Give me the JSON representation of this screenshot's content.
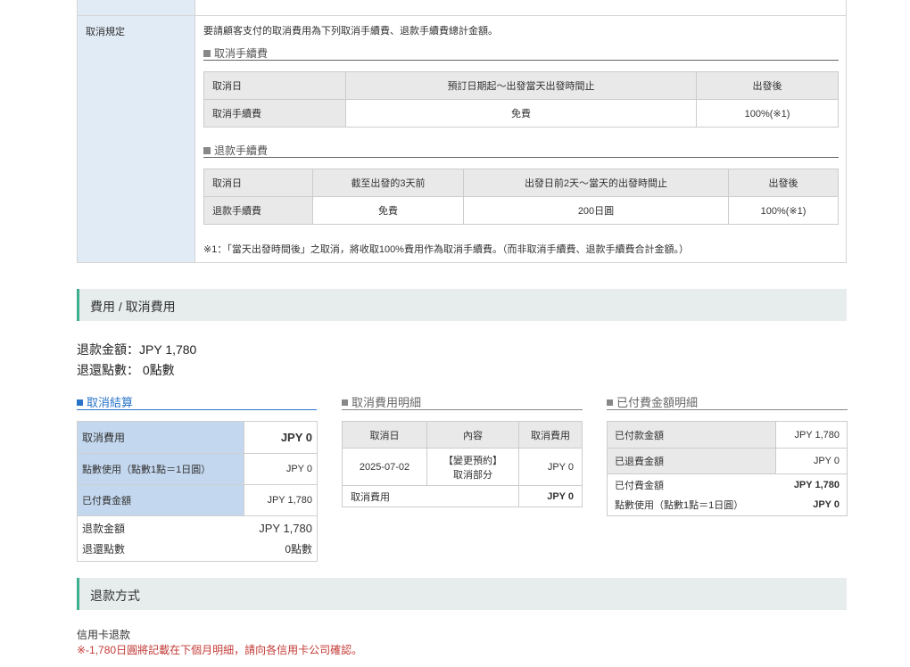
{
  "policy": {
    "label": "取消規定",
    "intro": "要請顧客支付的取消費用為下列取消手續費、退款手續費總計金額。",
    "cancel_fee": {
      "title": "取消手續費",
      "header": [
        "取消日",
        "預訂日期起～出發當天出發時間止",
        "出發後"
      ],
      "row": [
        "取消手續費",
        "免費",
        "100%(※1)"
      ]
    },
    "refund_fee": {
      "title": "退款手續費",
      "header": [
        "取消日",
        "截至出發的3天前",
        "出發日前2天～當天的出發時間止",
        "出發後"
      ],
      "row": [
        "退款手續費",
        "免費",
        "200日圓",
        "100%(※1)"
      ]
    },
    "note": "※1：「當天出發時間後」之取消，將收取100%費用作為取消手續費。（而非取消手續費、退款手續費合計金額。）"
  },
  "fees_section": {
    "title": "費用 / 取消費用",
    "refund_amount_label": "退款金額：",
    "refund_amount": "JPY 1,780",
    "refund_points_label": "退還點數：",
    "refund_points": "0點數"
  },
  "settlement": {
    "title": "取消結算",
    "rows": [
      {
        "label": "取消費用",
        "value": "JPY 0"
      },
      {
        "label": "點數使用（點數1點＝1日圓）",
        "value": "JPY 0"
      },
      {
        "label": "已付費金額",
        "value": "JPY 1,780"
      }
    ],
    "totals": [
      {
        "label": "退款金額",
        "value": "JPY 1,780"
      },
      {
        "label": "退還點數",
        "value": "0點數"
      }
    ]
  },
  "cancel_detail": {
    "title": "取消費用明細",
    "header": [
      "取消日",
      "內容",
      "取消費用"
    ],
    "row": {
      "date": "2025-07-02",
      "content_line1": "【變更預約】",
      "content_line2": "取消部分",
      "fee": "JPY 0"
    },
    "total_label": "取消費用",
    "total_value": "JPY 0"
  },
  "paid_detail": {
    "title": "已付費金額明細",
    "rows": [
      {
        "label": "已付款金額",
        "value": "JPY 1,780"
      },
      {
        "label": "已退費金額",
        "value": "JPY 0"
      },
      {
        "label": "已付費金額",
        "value": "JPY 1,780"
      },
      {
        "label": "點數使用（點數1點＝1日圓）",
        "value": "JPY 0"
      }
    ]
  },
  "refund_method": {
    "title": "退款方式",
    "method": "信用卡退款",
    "note": "※-1,780日圓將記載在下個月明細，請向各信用卡公司確認。"
  }
}
